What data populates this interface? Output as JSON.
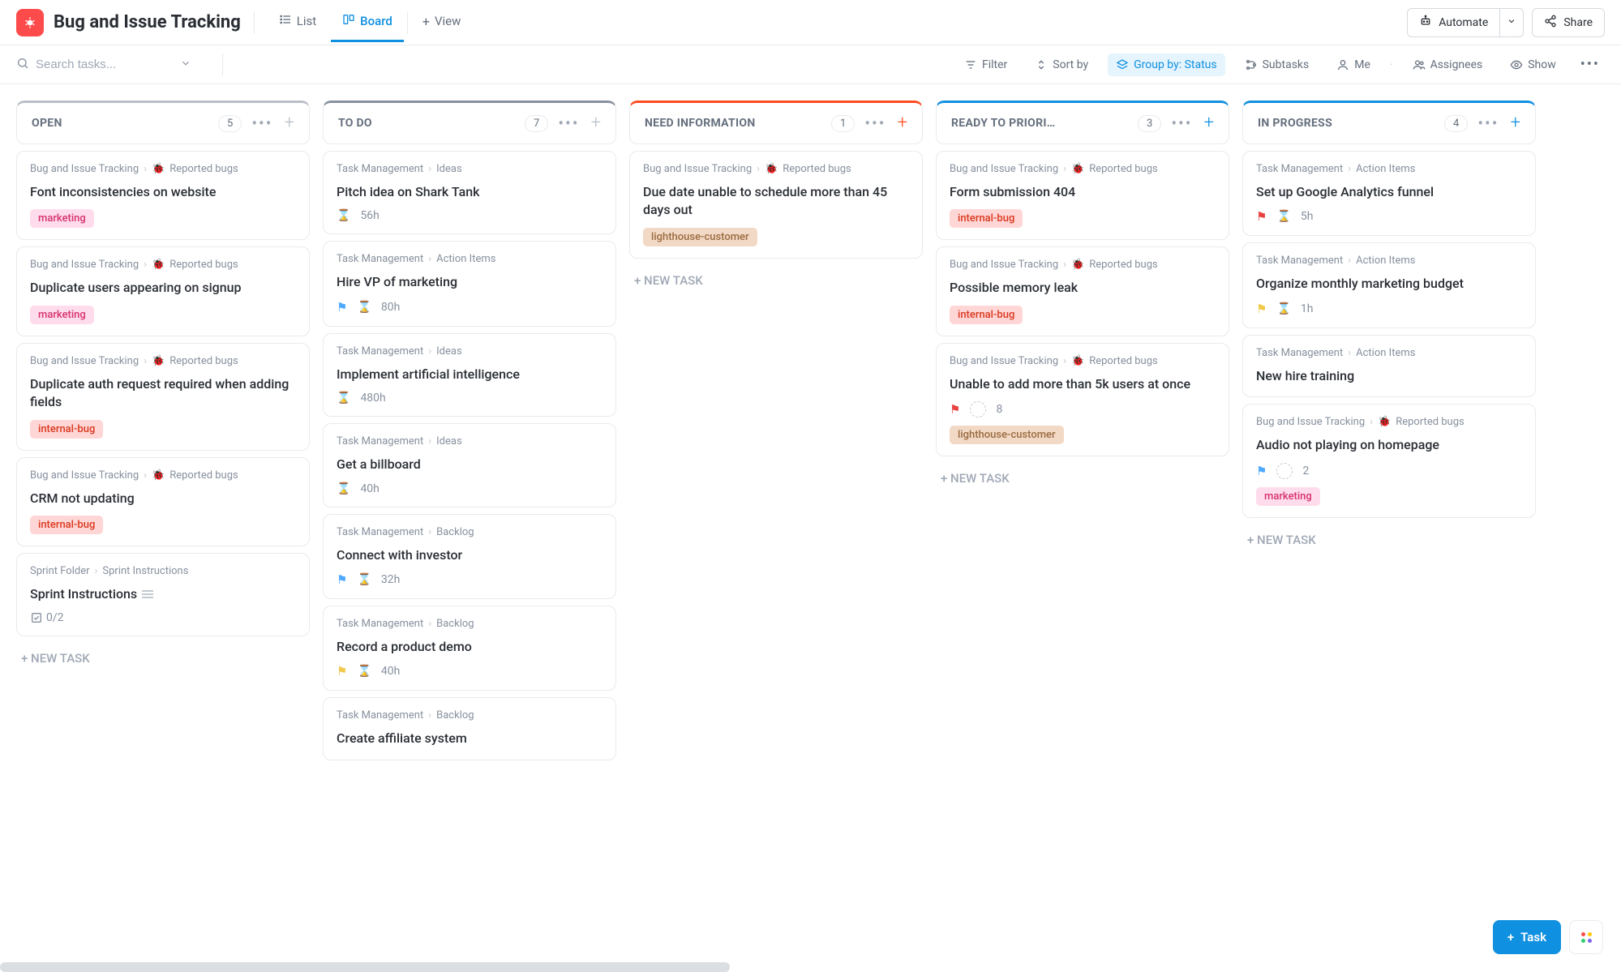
{
  "header": {
    "title": "Bug and Issue Tracking",
    "tabs": {
      "list": "List",
      "board": "Board",
      "view": "View"
    },
    "automate": "Automate",
    "share": "Share"
  },
  "toolbar": {
    "search_placeholder": "Search tasks...",
    "filter": "Filter",
    "sort": "Sort by",
    "group": "Group by: Status",
    "subtasks": "Subtasks",
    "me": "Me",
    "assignees": "Assignees",
    "show": "Show"
  },
  "newTaskLabel": "+ NEW TASK",
  "fab": {
    "task": "Task"
  },
  "columns": [
    {
      "title": "OPEN",
      "count": "5",
      "accent": "#b9bec7",
      "plus": "#b9bec7",
      "cards": [
        {
          "crumb1": "Bug and Issue Tracking",
          "crumb2": "Reported bugs",
          "bug": true,
          "title": "Font inconsistencies on website",
          "tags": [
            {
              "t": "marketing",
              "c": "tag-marketing"
            }
          ]
        },
        {
          "crumb1": "Bug and Issue Tracking",
          "crumb2": "Reported bugs",
          "bug": true,
          "title": "Duplicate users appearing on signup",
          "tags": [
            {
              "t": "marketing",
              "c": "tag-marketing"
            }
          ]
        },
        {
          "crumb1": "Bug and Issue Tracking",
          "crumb2": "Reported bugs",
          "bug": true,
          "title": "Duplicate auth request required when adding fields",
          "tags": [
            {
              "t": "internal-bug",
              "c": "tag-internal-bug"
            }
          ]
        },
        {
          "crumb1": "Bug and Issue Tracking",
          "crumb2": "Reported bugs",
          "bug": true,
          "title": "CRM not updating",
          "tags": [
            {
              "t": "internal-bug",
              "c": "tag-internal-bug"
            }
          ]
        },
        {
          "crumb1": "Sprint Folder",
          "crumb2": "Sprint Instructions",
          "bug": false,
          "title": "Sprint Instructions",
          "desc": true,
          "check": "0/2"
        }
      ]
    },
    {
      "title": "TO DO",
      "count": "7",
      "accent": "#87909e",
      "plus": "#b9bec7",
      "cards": [
        {
          "crumb1": "Task Management",
          "crumb2": "Ideas",
          "title": "Pitch idea on Shark Tank",
          "time": "56h"
        },
        {
          "crumb1": "Task Management",
          "crumb2": "Action Items",
          "title": "Hire VP of marketing",
          "flag": "flag-blue",
          "time": "80h"
        },
        {
          "crumb1": "Task Management",
          "crumb2": "Ideas",
          "title": "Implement artificial intelligence",
          "time": "480h"
        },
        {
          "crumb1": "Task Management",
          "crumb2": "Ideas",
          "title": "Get a billboard",
          "time": "40h"
        },
        {
          "crumb1": "Task Management",
          "crumb2": "Backlog",
          "title": "Connect with investor",
          "flag": "flag-blue",
          "time": "32h"
        },
        {
          "crumb1": "Task Management",
          "crumb2": "Backlog",
          "title": "Record a product demo",
          "flag": "flag-yellow",
          "time": "40h"
        },
        {
          "crumb1": "Task Management",
          "crumb2": "Backlog",
          "title": "Create affiliate system"
        }
      ],
      "noNewTask": true
    },
    {
      "title": "NEED INFORMATION",
      "count": "1",
      "accent": "#fd4b1f",
      "plus": "#fd4b1f",
      "cards": [
        {
          "crumb1": "Bug and Issue Tracking",
          "crumb2": "Reported bugs",
          "bug": true,
          "title": "Due date unable to schedule more than 45 days out",
          "tags": [
            {
              "t": "lighthouse-customer",
              "c": "tag-lighthouse"
            }
          ]
        }
      ]
    },
    {
      "title": "READY TO PRIORI…",
      "count": "3",
      "accent": "#1090e0",
      "plus": "#1090e0",
      "cards": [
        {
          "crumb1": "Bug and Issue Tracking",
          "crumb2": "Reported bugs",
          "bug": true,
          "title": "Form submission 404",
          "tags": [
            {
              "t": "internal-bug",
              "c": "tag-internal-bug"
            }
          ]
        },
        {
          "crumb1": "Bug and Issue Tracking",
          "crumb2": "Reported bugs",
          "bug": true,
          "title": "Possible memory leak",
          "tags": [
            {
              "t": "internal-bug",
              "c": "tag-internal-bug"
            }
          ]
        },
        {
          "crumb1": "Bug and Issue Tracking",
          "crumb2": "Reported bugs",
          "bug": true,
          "title": "Unable to add more than 5k users at once",
          "flag": "flag-red",
          "avatar": true,
          "num": "8",
          "tags": [
            {
              "t": "lighthouse-customer",
              "c": "tag-lighthouse"
            }
          ]
        }
      ]
    },
    {
      "title": "IN PROGRESS",
      "count": "4",
      "accent": "#1090e0",
      "plus": "#1090e0",
      "cards": [
        {
          "crumb1": "Task Management",
          "crumb2": "Action Items",
          "title": "Set up Google Analytics funnel",
          "flag": "flag-red",
          "time": "5h"
        },
        {
          "crumb1": "Task Management",
          "crumb2": "Action Items",
          "title": "Organize monthly marketing budget",
          "flag": "flag-yellow",
          "time": "1h"
        },
        {
          "crumb1": "Task Management",
          "crumb2": "Action Items",
          "title": "New hire training"
        },
        {
          "crumb1": "Bug and Issue Tracking",
          "crumb2": "Reported bugs",
          "bug": true,
          "title": "Audio not playing on homepage",
          "flag": "flag-blue",
          "avatar": true,
          "num": "2",
          "tags": [
            {
              "t": "marketing",
              "c": "tag-marketing"
            }
          ]
        }
      ]
    }
  ]
}
